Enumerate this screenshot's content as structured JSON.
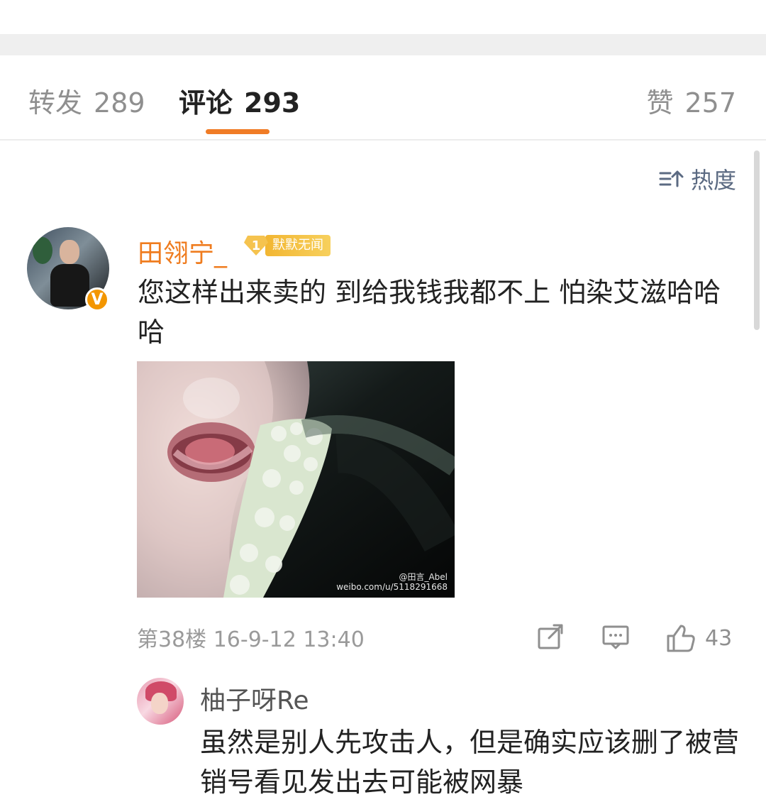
{
  "tabs": {
    "repost": {
      "label": "转发",
      "count": "289"
    },
    "comment": {
      "label": "评论",
      "count": "293"
    },
    "like": {
      "label": "赞",
      "count": "257"
    }
  },
  "sort": {
    "label": "热度",
    "icon": "sort-icon"
  },
  "comment": {
    "username": "田翎宁_",
    "member_level": "1",
    "member_badge": "默默无闻",
    "verified_mark": "V",
    "text": "您这样出来卖的 到给我钱我都不上 怕染艾滋哈哈哈",
    "image_watermark_line1": "@田言_Abel",
    "image_watermark_line2": "weibo.com/u/5118291668",
    "meta": "第38楼 16-9-12 13:40",
    "like_count": "43"
  },
  "reply": {
    "username": "柚子呀Re",
    "text": "虽然是别人先攻击人，但是确实应该删了被营销号看见发出去可能被网暴"
  },
  "colors": {
    "accent": "#f07c26",
    "username": "#ef7c1f",
    "secondary_text": "#8f8f8f",
    "badge": "#f5c34f"
  }
}
